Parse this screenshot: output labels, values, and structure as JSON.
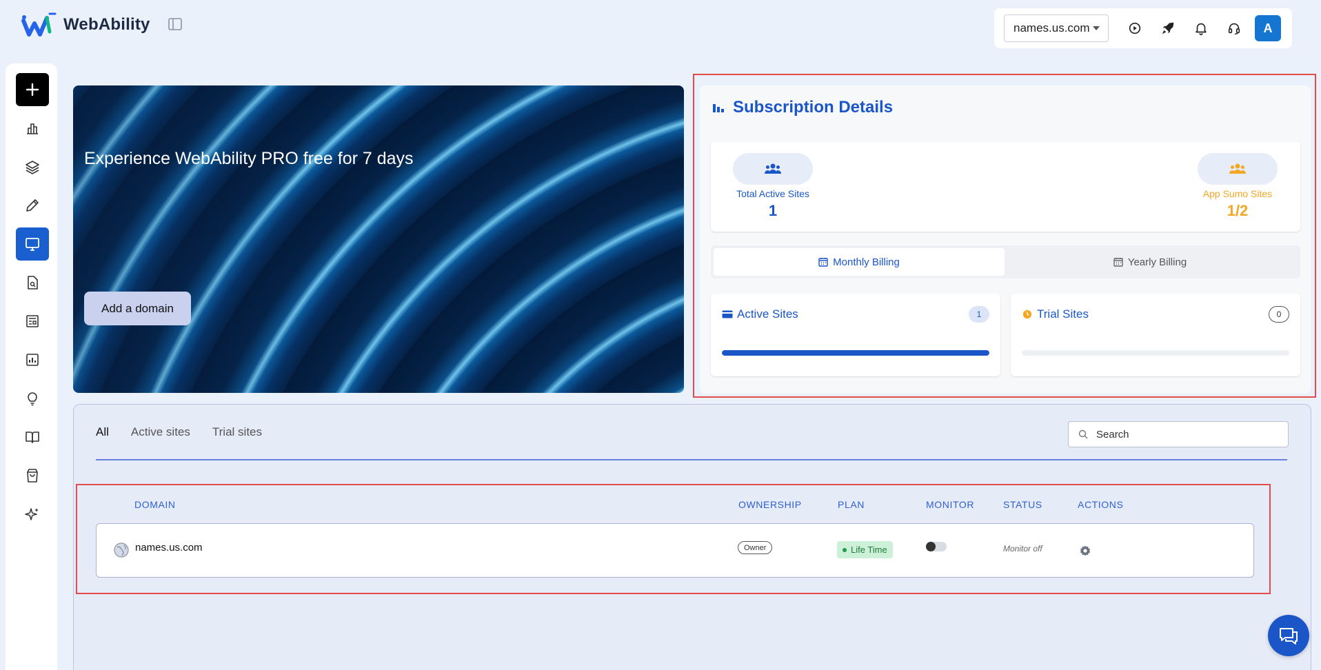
{
  "app": {
    "logo_text": "WebAbility"
  },
  "header": {
    "domain_select": "names.us.com",
    "avatar_letter": "A",
    "icons": [
      "play-circle-icon",
      "rocket-icon",
      "bell-icon",
      "headset-icon"
    ]
  },
  "sidebar": {
    "items": [
      {
        "name": "add-icon"
      },
      {
        "name": "bar-chart-icon"
      },
      {
        "name": "layers-icon"
      },
      {
        "name": "pencil-icon"
      },
      {
        "name": "monitor-icon",
        "active": true
      },
      {
        "name": "file-search-icon"
      },
      {
        "name": "newspaper-icon"
      },
      {
        "name": "chart-square-icon"
      },
      {
        "name": "lightbulb-icon"
      },
      {
        "name": "book-open-icon"
      },
      {
        "name": "shopping-bag-icon"
      },
      {
        "name": "sparkles-icon"
      }
    ]
  },
  "hero": {
    "title": "Experience WebAbility PRO free for 7 days",
    "button_label": "Add a domain"
  },
  "subscription": {
    "title": "Subscription Details",
    "total_active_label": "Total Active Sites",
    "total_active_value": "1",
    "app_sumo_label": "App Sumo Sites",
    "app_sumo_value": "1/2",
    "tabs": {
      "monthly": "Monthly Billing",
      "yearly": "Yearly Billing",
      "active": "monthly"
    },
    "active_sites": {
      "label": "Active Sites",
      "count": "1",
      "progress": 1.0
    },
    "trial_sites": {
      "label": "Trial Sites",
      "count": "0",
      "progress": 0.0
    },
    "colors": {
      "blue": "#1a56c7",
      "orange": "#f5a623"
    }
  },
  "sites": {
    "tabs": [
      "All",
      "Active sites",
      "Trial sites"
    ],
    "active_tab": "All",
    "search_placeholder": "Search",
    "columns": [
      "DOMAIN",
      "OWNERSHIP",
      "PLAN",
      "MONITOR",
      "STATUS",
      "ACTIONS"
    ],
    "rows": [
      {
        "domain": "names.us.com",
        "ownership": "Owner",
        "plan": "Life Time",
        "monitor": false,
        "status": "Monitor off"
      }
    ]
  }
}
